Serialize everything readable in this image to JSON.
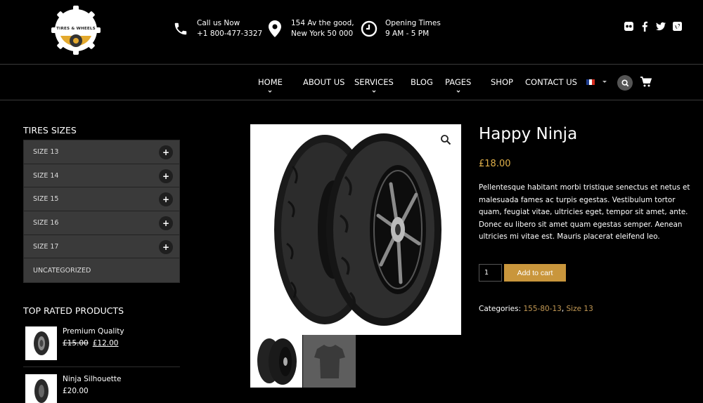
{
  "header": {
    "logo_text": "TIRES & WHEELS",
    "call_label": "Call us Now",
    "call_number": "+1 800-477-3327",
    "address_line1": "154 Av the good,",
    "address_line2": "New York 50 000",
    "hours_label": "Opening Times",
    "hours_value": "9 AM - 5 PM",
    "social": [
      "flickr-icon",
      "facebook-icon",
      "twitter-icon",
      "vimeo-icon"
    ]
  },
  "nav": {
    "items": [
      {
        "label": "HOME",
        "has_sub": true
      },
      {
        "label": "ABOUT US",
        "has_sub": false
      },
      {
        "label": "SERVICES",
        "has_sub": true
      },
      {
        "label": "BLOG",
        "has_sub": false
      },
      {
        "label": "PAGES",
        "has_sub": true
      },
      {
        "label": "SHOP",
        "has_sub": false
      },
      {
        "label": "CONTACT US",
        "has_sub": false
      }
    ]
  },
  "sidebar": {
    "sizes_title": "TIRES SIZES",
    "categories": [
      "SIZE 13",
      "SIZE 14",
      "SIZE 15",
      "SIZE 16",
      "SIZE 17",
      "UNCATEGORIZED"
    ],
    "top_rated_title": "TOP RATED PRODUCTS",
    "top_rated": [
      {
        "name": "Premium Quality",
        "old_price": "£15.00",
        "price": "£12.00"
      },
      {
        "name": "Ninja Silhouette",
        "old_price": "",
        "price": "£20.00"
      }
    ]
  },
  "product": {
    "title": "Happy Ninja",
    "price": "£18.00",
    "description": "Pellentesque habitant morbi tristique senectus et netus et malesuada fames ac turpis egestas. Vestibulum tortor quam, feugiat vitae, ultricies eget, tempor sit amet, ante. Donec eu libero sit amet quam egestas semper. Aenean ultricies mi vitae est. Mauris placerat eleifend leo.",
    "quantity": "1",
    "add_to_cart": "Add to cart",
    "categories_label": "Categories:",
    "categories": [
      "155-80-13",
      "Size 13"
    ],
    "category_separator": ", "
  },
  "colors": {
    "accent": "#c9963c",
    "price": "#e0b04a",
    "link": "#c49a55",
    "panel": "#3a3a3a"
  }
}
